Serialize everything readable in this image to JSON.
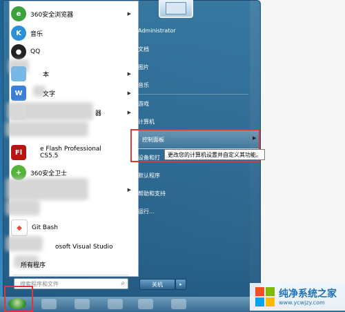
{
  "start_menu": {
    "programs": [
      {
        "label": "360安全浏览器",
        "has_submenu": true,
        "icon": "browser-icon",
        "color": "#3aa23a"
      },
      {
        "label": "音乐",
        "has_submenu": false,
        "icon": "music-icon",
        "color": "#2b8fd9"
      },
      {
        "label": "QQ",
        "has_submenu": false,
        "icon": "penguin-icon",
        "color": "#222222"
      },
      {
        "label": "本",
        "has_submenu": true,
        "icon": "notepad-icon",
        "color": "#79b7e4"
      },
      {
        "label": "文字",
        "has_submenu": true,
        "icon": "word-icon",
        "color": "#3c7fd6"
      },
      {
        "label": "器",
        "has_submenu": true,
        "icon": "app-icon",
        "color": "#d9d9d9"
      },
      {
        "label": "e Flash Professional",
        "sublabel": "CS5.5",
        "has_submenu": false,
        "icon": "flash-icon",
        "color": "#b81414"
      },
      {
        "label": "360安全卫士",
        "has_submenu": false,
        "icon": "shield-plus-icon",
        "color": "#56b43a"
      },
      {
        "label": "",
        "has_submenu": true,
        "icon": "blurred-icon",
        "color": "#cccccc"
      },
      {
        "label": "Git Bash",
        "has_submenu": false,
        "icon": "git-icon",
        "color": "#e84e31"
      },
      {
        "label": "osoft Visual Studio",
        "has_submenu": false,
        "icon": "vs-icon",
        "color": "#6b4fa3"
      },
      {
        "label": "所有程序",
        "has_submenu": false,
        "icon": "",
        "color": ""
      }
    ],
    "search_placeholder": "搜索程序和文件",
    "right_items": [
      "Administrator",
      "文档",
      "图片",
      "音乐",
      "游戏",
      "计算机",
      "控制面板",
      "设备和打",
      "默认程序",
      "帮助和支持",
      "运行..."
    ],
    "tooltip": "更改您的计算机设置并自定义其功能。",
    "shutdown_label": "关机",
    "shutdown_arrow": "▸"
  },
  "watermark": {
    "title": "纯净系统之家",
    "url": "www.ycwjzy.com"
  },
  "colors": {
    "highlight_box": "#d83a3a",
    "menu_blue": "#2c6c99"
  }
}
